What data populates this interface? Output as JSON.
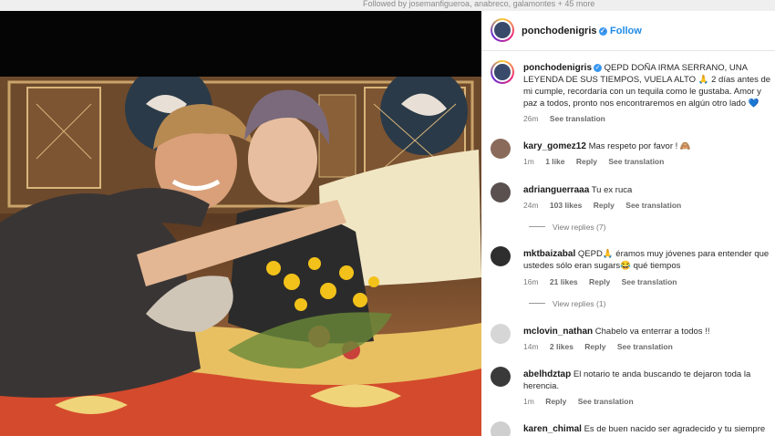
{
  "top_bar": {
    "followed_by": "Followed by josemanfigueroa, anabreco, galamontes + 45 more"
  },
  "header": {
    "username": "ponchodenigris",
    "follow_label": "Follow"
  },
  "caption": {
    "username": "ponchodenigris",
    "text": "QEPD DOÑA IRMA SERRANO, UNA LEYENDA DE SUS TIEMPOS, VUELA ALTO 🙏 2 días antes de mi cumple, recordaría con un tequila como le gustaba. Amor y paz a todos, pronto nos encontraremos en algún otro lado 💙",
    "time": "26m",
    "see_translation": "See translation"
  },
  "comments": [
    {
      "username": "kary_gomez12",
      "text": "Mas respeto por favor ! 🙈",
      "time": "1m",
      "likes": "1 like",
      "reply": "Reply",
      "see_translation": "See translation"
    },
    {
      "username": "adrianguerraaa",
      "text": "Tu ex rucа",
      "time": "24m",
      "likes": "103 likes",
      "reply": "Reply",
      "see_translation": "See translation",
      "view_replies": "View replies (7)"
    },
    {
      "username": "mktbaizabal",
      "text": "QEPD🙏 éramos muy jóvenes para entender que ustedes sólo eran sugars😂 qué tiempos",
      "time": "16m",
      "likes": "21 likes",
      "reply": "Reply",
      "see_translation": "See translation",
      "view_replies": "View replies (1)"
    },
    {
      "username": "mclovin_nathan",
      "text": "Chabelo va enterrar a todos !!",
      "time": "14m",
      "likes": "2 likes",
      "reply": "Reply",
      "see_translation": "See translation"
    },
    {
      "username": "abelhdztap",
      "text": "El notario te anda buscando te dejaron toda la herencia.",
      "time": "1m",
      "likes": "",
      "reply": "Reply",
      "see_translation": "See translation"
    },
    {
      "username": "karen_chimal",
      "text": "Es de buen nacido ser agradecido y tu siempre",
      "time": "",
      "likes": "",
      "reply": "",
      "see_translation": ""
    }
  ]
}
